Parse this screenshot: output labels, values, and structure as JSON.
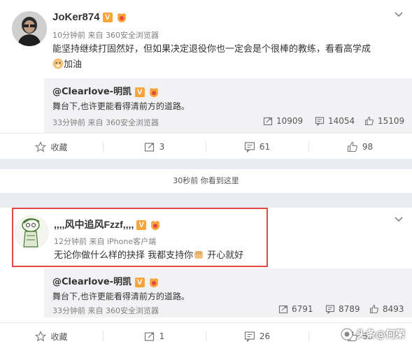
{
  "posts": [
    {
      "username": "JoKer874",
      "meta": "10分钟前 来自 360安全浏览器",
      "content_line1": "能坚持继续打固然好，但如果决定退役你也一定会是个很棒的教练，看看高学成",
      "content_line2": "加油",
      "quote": {
        "username": "@Clearlove-明凯",
        "text": "舞台下,也许更能看得清前方的道路。",
        "meta": "33分钟前 来自 360安全浏览器",
        "reposts": "10909",
        "comments": "14054",
        "likes": "15109"
      },
      "actions": {
        "favorite": "收藏",
        "repost": "3",
        "comment": "61",
        "like": "98"
      }
    },
    {
      "username": ",,,,风中追风Fzzf,,,,",
      "meta": "12分钟前 来自 iPhone客户端",
      "content_line1a": "无论你做什么样的抉择 我都支持你",
      "content_line1b": " 开心就好",
      "quote": {
        "username": "@Clearlove-明凯",
        "text": "舞台下,也许更能看得清前方的道路。",
        "meta": "33分钟前 来自 360安全浏览器",
        "reposts": "6791",
        "comments": "8789",
        "likes": "8493"
      },
      "actions": {
        "favorite": "收藏",
        "repost": "1",
        "comment": "26",
        "like": "65"
      }
    }
  ],
  "notice": "30秒前 你看到这里",
  "badge_v": "V",
  "watermark": "头条@何荣",
  "colors": {
    "highlight": "#e24747",
    "badge": "#f7a43a",
    "background": "#e9edf2"
  }
}
